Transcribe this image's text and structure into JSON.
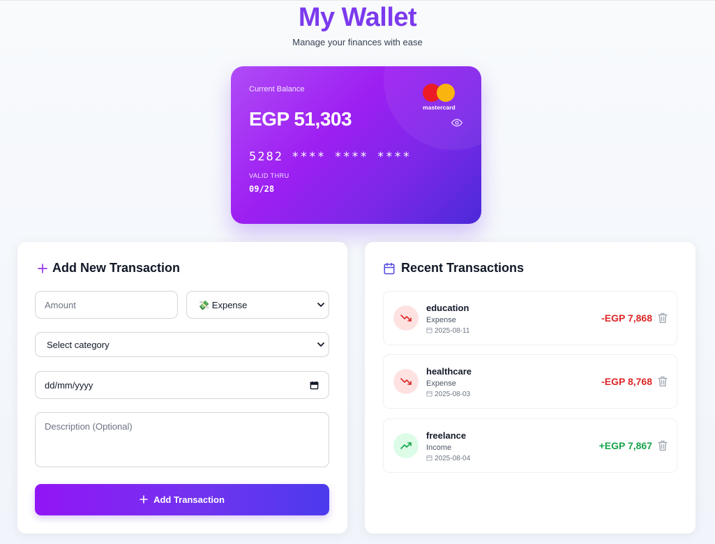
{
  "header": {
    "title": "My Wallet",
    "subtitle": "Manage your finances with ease"
  },
  "card": {
    "label": "Current Balance",
    "balance": "EGP 51,303",
    "brand": "mastercard",
    "number": "5282 **** **** ****",
    "valid_label": "VALID THRU",
    "valid_value": "09/28",
    "eye_icon": "eye-icon"
  },
  "form": {
    "title": "Add New Transaction",
    "amount_placeholder": "Amount",
    "type_value": "💸 Expense",
    "category_value": "Select category",
    "date_value": "dd/mm/yyyy",
    "description_placeholder": "Description (Optional)",
    "submit_label": "Add Transaction"
  },
  "recent": {
    "title": "Recent Transactions",
    "items": [
      {
        "name": "education",
        "type": "Expense",
        "date": "2025-08-11",
        "amount": "-EGP 7,868",
        "kind": "expense"
      },
      {
        "name": "healthcare",
        "type": "Expense",
        "date": "2025-08-03",
        "amount": "-EGP 8,768",
        "kind": "expense"
      },
      {
        "name": "freelance",
        "type": "Income",
        "date": "2025-08-04",
        "amount": "+EGP 7,867",
        "kind": "income"
      }
    ]
  },
  "colors": {
    "accent": "#7c3aed",
    "expense": "#dc2626",
    "income": "#16a34a"
  }
}
